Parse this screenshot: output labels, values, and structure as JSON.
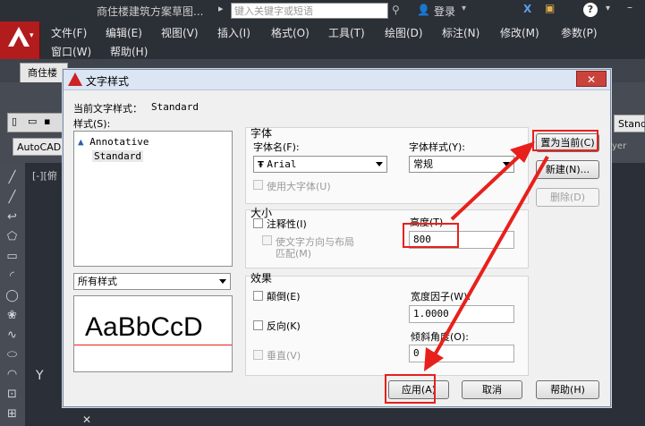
{
  "titlebar": {
    "doc_title": "商住楼建筑方案草图...",
    "search_placeholder": "键入关键字或短语",
    "login_label": "登录",
    "help_symbol": "?"
  },
  "menu": {
    "items": [
      "文件(F)",
      "编辑(E)",
      "视图(V)",
      "插入(I)",
      "格式(O)",
      "工具(T)",
      "绘图(D)",
      "标注(N)",
      "修改(M)",
      "参数(P)",
      "窗口(W)",
      "帮助(H)"
    ]
  },
  "doc_tab": "商住楼",
  "toolbar_text": {
    "autocad_combo": "AutoCAD",
    "right_combo": "Stand",
    "layer_text": "yer"
  },
  "viewport_label": "[-][俯",
  "dialog": {
    "title": "文字样式",
    "close_symbol": "✕",
    "current_style_label": "当前文字样式：",
    "current_style_value": "Standard",
    "styles_label": "样式(S):",
    "styles": [
      "Annotative",
      "Standard"
    ],
    "filter_value": "所有样式",
    "preview_text": "AaBbCcD",
    "font": {
      "group_label": "字体",
      "font_name_label": "字体名(F):",
      "font_name_value": "Arial",
      "font_style_label": "字体样式(Y):",
      "font_style_value": "常规",
      "big_font_label": "使用大字体(U)"
    },
    "size": {
      "group_label": "大小",
      "annotative_label": "注释性(I)",
      "match_orientation_label": "使文字方向与布局",
      "match_orientation_label2": "匹配(M)",
      "height_label": "高度(T)",
      "height_value": "800"
    },
    "effects": {
      "group_label": "效果",
      "upside_down_label": "颠倒(E)",
      "backwards_label": "反向(K)",
      "vertical_label": "垂直(V)",
      "width_factor_label": "宽度因子(W):",
      "width_factor_value": "1.0000",
      "oblique_angle_label": "倾斜角度(O):",
      "oblique_angle_value": "0"
    },
    "buttons": {
      "set_current": "置为当前(C)",
      "new": "新建(N)...",
      "delete": "删除(D)",
      "apply": "应用(A)",
      "cancel": "取消",
      "help": "帮助(H)"
    }
  },
  "annotation_color": "#e8201c"
}
